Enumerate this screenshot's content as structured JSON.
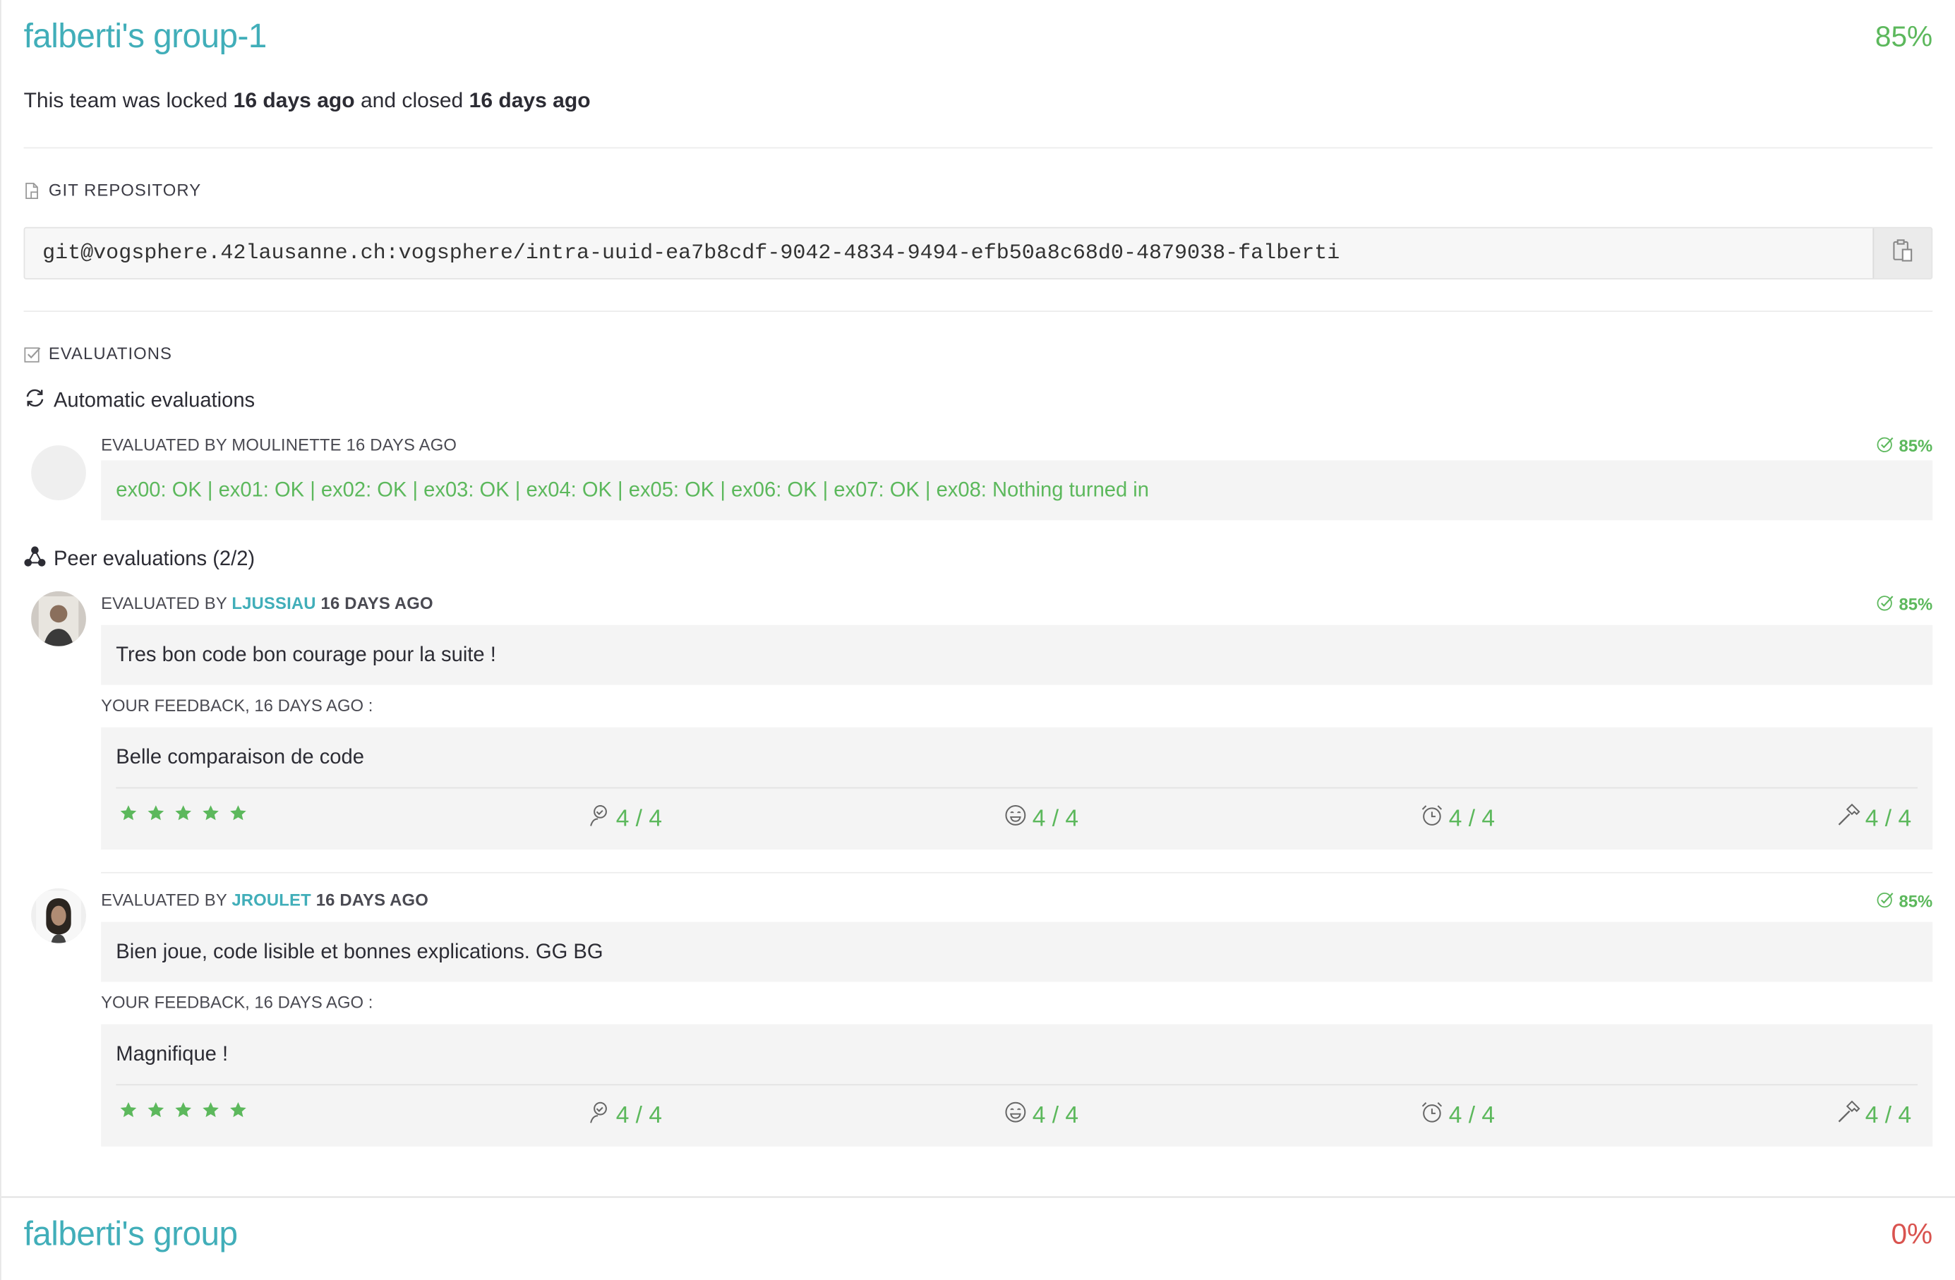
{
  "team1": {
    "name": "falberti's group-1",
    "score": "85%",
    "lock_prefix": "This team was locked",
    "locked_when": "16 days ago",
    "lock_middle": "and closed",
    "closed_when": "16 days ago"
  },
  "git": {
    "title": "GIT REPOSITORY",
    "url": "git@vogsphere.42lausanne.ch:vogsphere/intra-uuid-ea7b8cdf-9042-4834-9494-efb50a8c68d0-4879038-falberti"
  },
  "evaluations": {
    "title": "EVALUATIONS",
    "automatic": {
      "title": "Automatic evaluations",
      "meta": "EVALUATED BY MOULINETTE 16 DAYS AGO",
      "score": "85%",
      "result": "ex00: OK | ex01: OK | ex02: OK | ex03: OK | ex04: OK | ex05: OK | ex06: OK | ex07: OK | ex08: Nothing turned in"
    },
    "peer": {
      "title": "Peer evaluations (2/2)",
      "items": [
        {
          "evaluated_by": "EVALUATED BY",
          "login": "LJUSSIAU",
          "when": "16 DAYS AGO",
          "score": "85%",
          "comment": "Tres bon code bon courage pour la suite !",
          "feedback_label": "YOUR FEEDBACK,  16 DAYS AGO :",
          "feedback": "Belle comparaison de code",
          "stars": 5,
          "metrics": [
            "4 / 4",
            "4 / 4",
            "4 / 4",
            "4 / 4"
          ]
        },
        {
          "evaluated_by": "EVALUATED BY",
          "login": "JROULET",
          "when": "16 DAYS AGO",
          "score": "85%",
          "comment": "Bien joue, code lisible et bonnes explications. GG BG",
          "feedback_label": "YOUR FEEDBACK,  16 DAYS AGO :",
          "feedback": "Magnifique !",
          "stars": 5,
          "metrics": [
            "4 / 4",
            "4 / 4",
            "4 / 4",
            "4 / 4"
          ]
        }
      ]
    }
  },
  "team2": {
    "name": "falberti's group",
    "score": "0%"
  },
  "colors": {
    "accent": "#41aeb9",
    "success": "#5cb85c",
    "danger": "#d9534f"
  },
  "icons": {
    "git": "file-icon",
    "evaluations": "checkbox-icon",
    "automatic": "refresh-icon",
    "peer": "network-icon",
    "copy": "clipboard-icon",
    "metrics": [
      "interested-icon",
      "smile-icon",
      "alarm-clock-icon",
      "hammer-icon"
    ]
  }
}
